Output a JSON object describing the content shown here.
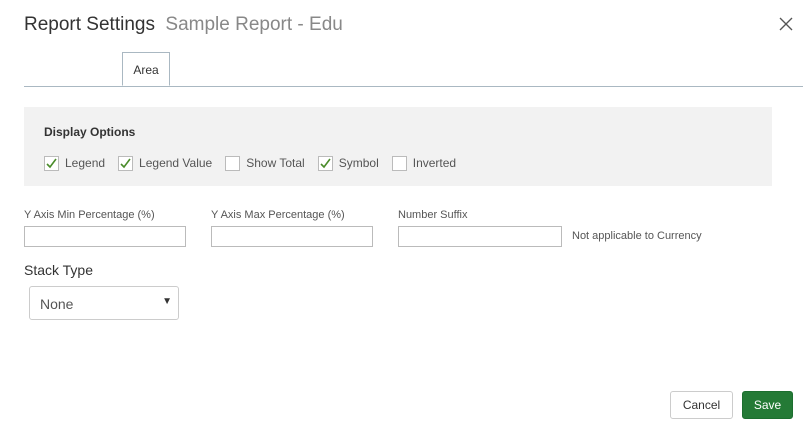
{
  "header": {
    "title": "Report Settings",
    "subtitle": "Sample Report - Edu"
  },
  "tabs": [
    {
      "label": "Area",
      "active": true
    }
  ],
  "display_options": {
    "title": "Display Options",
    "items": [
      {
        "label": "Legend",
        "checked": true
      },
      {
        "label": "Legend Value",
        "checked": true
      },
      {
        "label": "Show Total",
        "checked": false
      },
      {
        "label": "Symbol",
        "checked": true
      },
      {
        "label": "Inverted",
        "checked": false
      }
    ]
  },
  "fields": {
    "y_min": {
      "label": "Y Axis Min Percentage (%)",
      "value": ""
    },
    "y_max": {
      "label": "Y Axis Max Percentage (%)",
      "value": ""
    },
    "suffix": {
      "label": "Number Suffix",
      "value": "",
      "note": "Not applicable to Currency"
    }
  },
  "stack_type": {
    "label": "Stack Type",
    "selected": "None"
  },
  "buttons": {
    "cancel": "Cancel",
    "save": "Save"
  },
  "colors": {
    "check": "#4a8c2a",
    "save_bg": "#247a36",
    "panel_bg": "#f2f2f2"
  }
}
